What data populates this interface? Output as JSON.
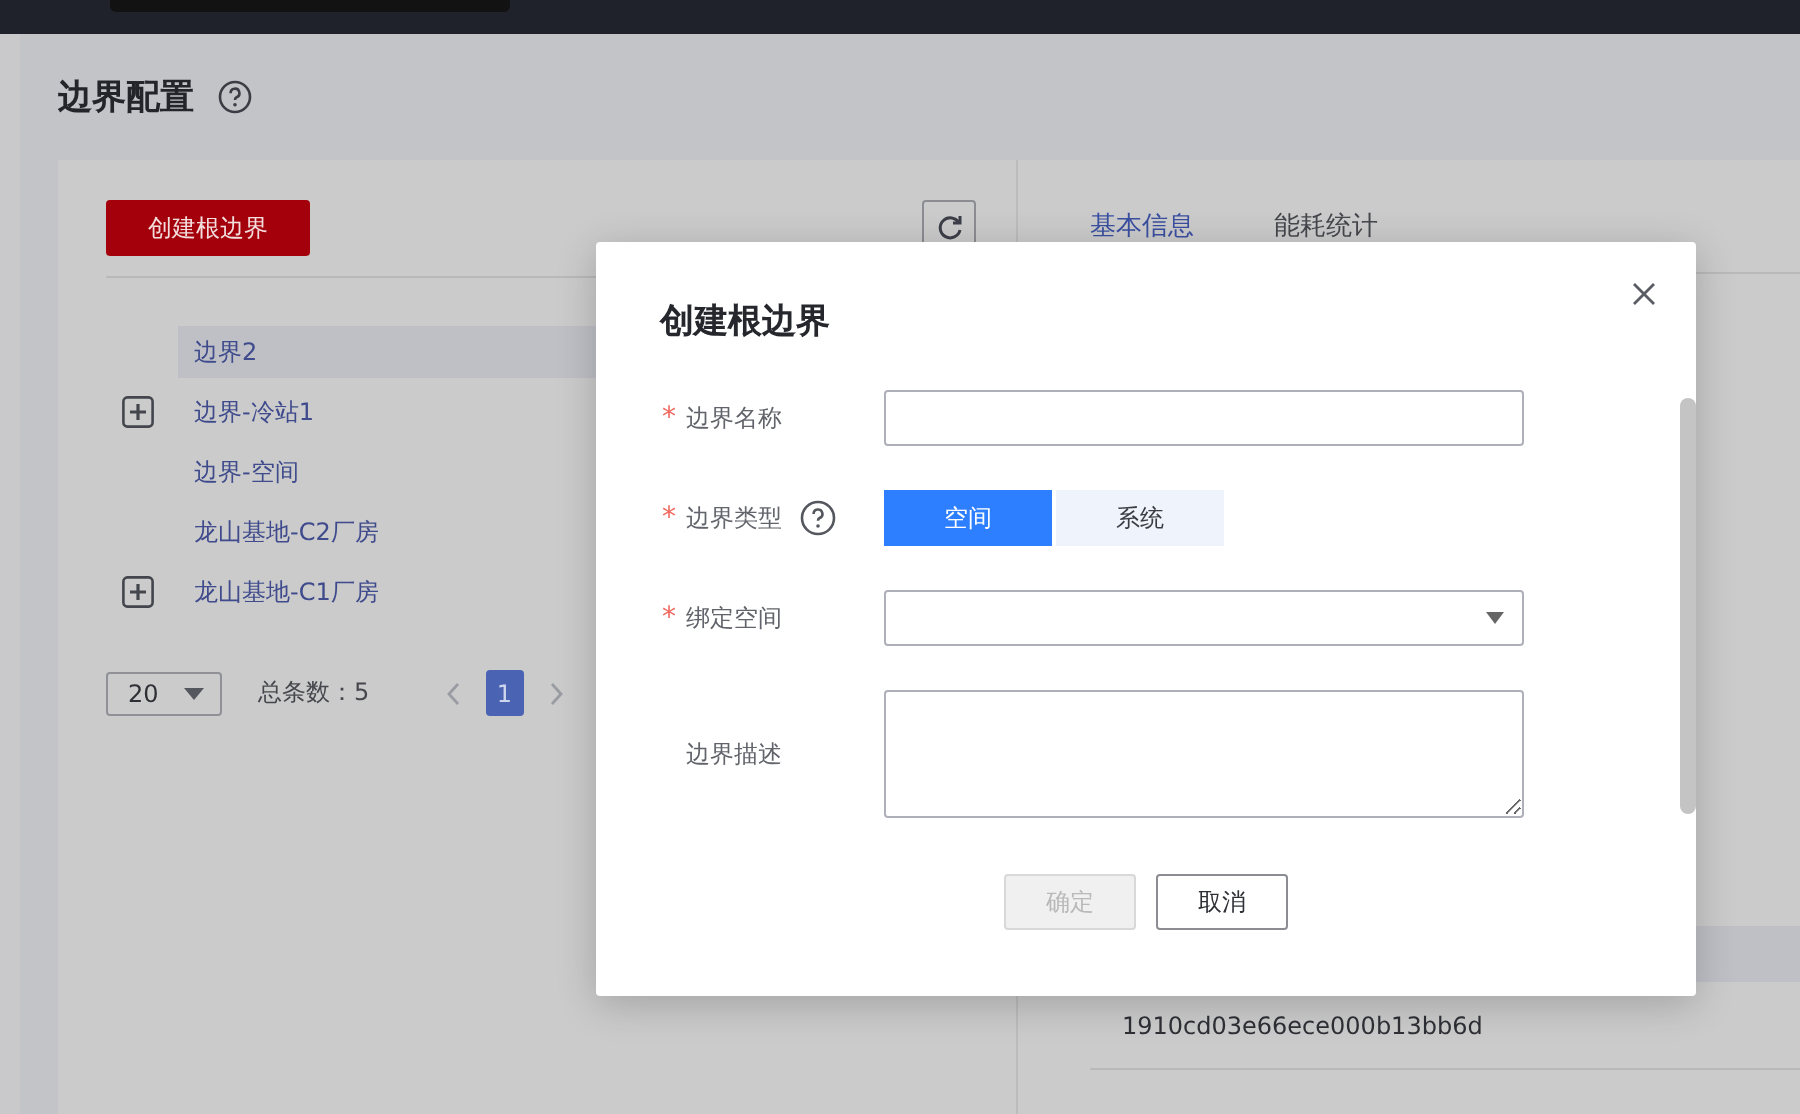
{
  "page": {
    "title": "边界配置"
  },
  "toolbar": {
    "create_button": "创建根边界"
  },
  "tree": [
    {
      "label": "边界2",
      "selected": true,
      "has_children": false
    },
    {
      "label": "边界-冷站1",
      "selected": false,
      "has_children": true
    },
    {
      "label": "边界-空间",
      "selected": false,
      "has_children": false
    },
    {
      "label": "龙山基地-C2厂房",
      "selected": false,
      "has_children": false
    },
    {
      "label": "龙山基地-C1厂房",
      "selected": false,
      "has_children": true
    }
  ],
  "pagination": {
    "page_size": "20",
    "total": "总条数：5",
    "pages": [
      {
        "label": "1",
        "selected": true
      }
    ]
  },
  "detail": {
    "tabs": [
      {
        "label": "基本信息",
        "selected": true
      },
      {
        "label": "能耗统计",
        "selected": false
      }
    ],
    "id_value": "1910cd03e66ece000b13bb6d"
  },
  "dialog": {
    "title": "创建根边界",
    "fields": [
      {
        "kind": "text",
        "label": "边界名称",
        "required_mark": "*"
      },
      {
        "kind": "segmented",
        "label": "边界类型",
        "required_mark": "*",
        "help": true,
        "options": [
          {
            "label": "空间",
            "selected": true
          },
          {
            "label": "系统",
            "selected": false
          }
        ]
      },
      {
        "kind": "select",
        "label": "绑定空间",
        "required_mark": "*"
      },
      {
        "kind": "textarea",
        "label": "边界描述"
      }
    ],
    "buttons": [
      {
        "label": "确定",
        "disabled": true
      },
      {
        "label": "取消",
        "disabled": false
      }
    ]
  }
}
